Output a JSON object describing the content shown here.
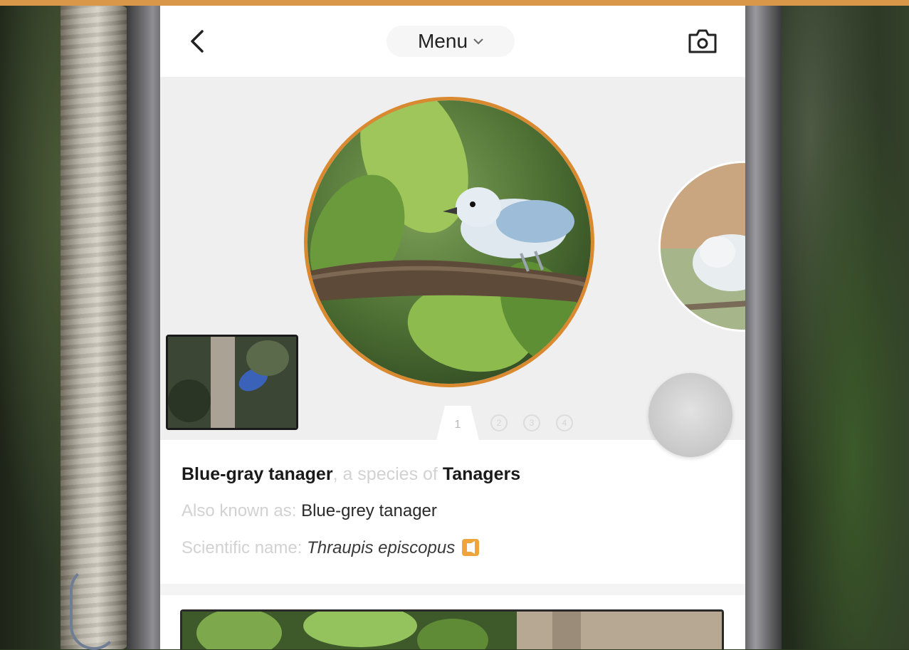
{
  "header": {
    "back_icon": "chevron-left-icon",
    "menu_label": "Menu",
    "menu_icon": "chevron-down-icon",
    "camera_icon": "camera-icon"
  },
  "carousel": {
    "active_page": "1",
    "page_numbers": [
      "2",
      "3",
      "4"
    ],
    "accent_color": "#d9892f"
  },
  "species": {
    "common_name": "Blue-gray tanager",
    "species_of_text": ", a species of ",
    "family": "Tanagers",
    "aka_label": "Also known as: ",
    "aka_value": "Blue-grey tanager",
    "sci_label": "Scientific name: ",
    "sci_value": "Thraupis episcopus",
    "audio_icon": "speaker-icon",
    "audio_color": "#f0a43c"
  }
}
